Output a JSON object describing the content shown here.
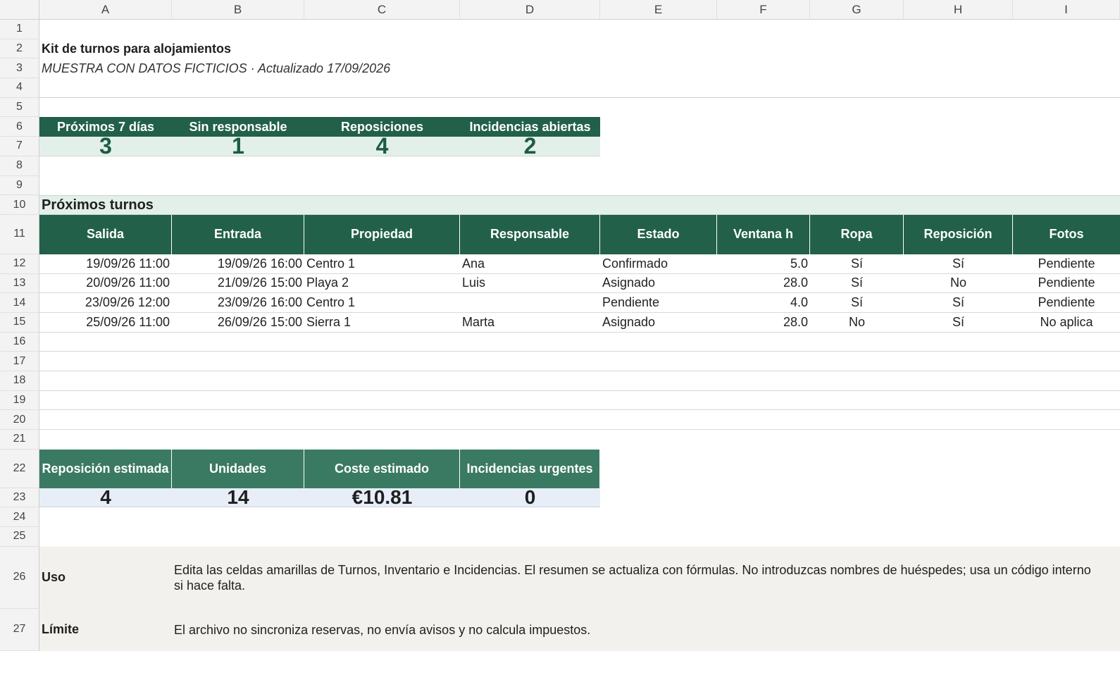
{
  "columns": [
    "A",
    "B",
    "C",
    "D",
    "E",
    "F",
    "G",
    "H",
    "I"
  ],
  "rows": [
    "1",
    "2",
    "3",
    "4",
    "5",
    "6",
    "7",
    "8",
    "9",
    "10",
    "11",
    "12",
    "13",
    "14",
    "15",
    "16",
    "17",
    "18",
    "19",
    "20",
    "21",
    "22",
    "23",
    "24",
    "25",
    "26",
    "27"
  ],
  "title": "Kit de turnos para alojamientos",
  "subtitle": "MUESTRA CON DATOS FICTICIOS · Actualizado 17/09/2026",
  "kpis": [
    {
      "label": "Próximos 7 días",
      "value": "3"
    },
    {
      "label": "Sin responsable",
      "value": "1"
    },
    {
      "label": "Reposiciones",
      "value": "4"
    },
    {
      "label": "Incidencias abiertas",
      "value": "2"
    }
  ],
  "section_title": "Próximos turnos",
  "table_headers": [
    "Salida",
    "Entrada",
    "Propiedad",
    "Responsable",
    "Estado",
    "Ventana h",
    "Ropa",
    "Reposición",
    "Fotos"
  ],
  "table_rows": [
    [
      "19/09/26 11:00",
      "19/09/26 16:00",
      "Centro 1",
      "Ana",
      "Confirmado",
      "5.0",
      "Sí",
      "Sí",
      "Pendiente"
    ],
    [
      "20/09/26 11:00",
      "21/09/26 15:00",
      "Playa 2",
      "Luis",
      "Asignado",
      "28.0",
      "Sí",
      "No",
      "Pendiente"
    ],
    [
      "23/09/26 12:00",
      "23/09/26 16:00",
      "Centro 1",
      "",
      "Pendiente",
      "4.0",
      "Sí",
      "Sí",
      "Pendiente"
    ],
    [
      "25/09/26 11:00",
      "26/09/26 15:00",
      "Sierra 1",
      "Marta",
      "Asignado",
      "28.0",
      "No",
      "Sí",
      "No aplica"
    ]
  ],
  "replenishment": [
    {
      "label": "Reposición estimada",
      "value": "4"
    },
    {
      "label": "Unidades",
      "value": "14"
    },
    {
      "label": "Coste estimado",
      "value": "€10.81"
    },
    {
      "label": "Incidencias urgentes",
      "value": "0"
    }
  ],
  "notes": [
    {
      "label": "Uso",
      "text": "Edita las celdas amarillas de Turnos, Inventario e Incidencias. El resumen se actualiza con fórmulas. No introduzcas nombres de huéspedes; usa un código interno si hace falta."
    },
    {
      "label": "Límite",
      "text": "El archivo no sincroniza reservas, no envía avisos y no calcula impuestos."
    }
  ]
}
